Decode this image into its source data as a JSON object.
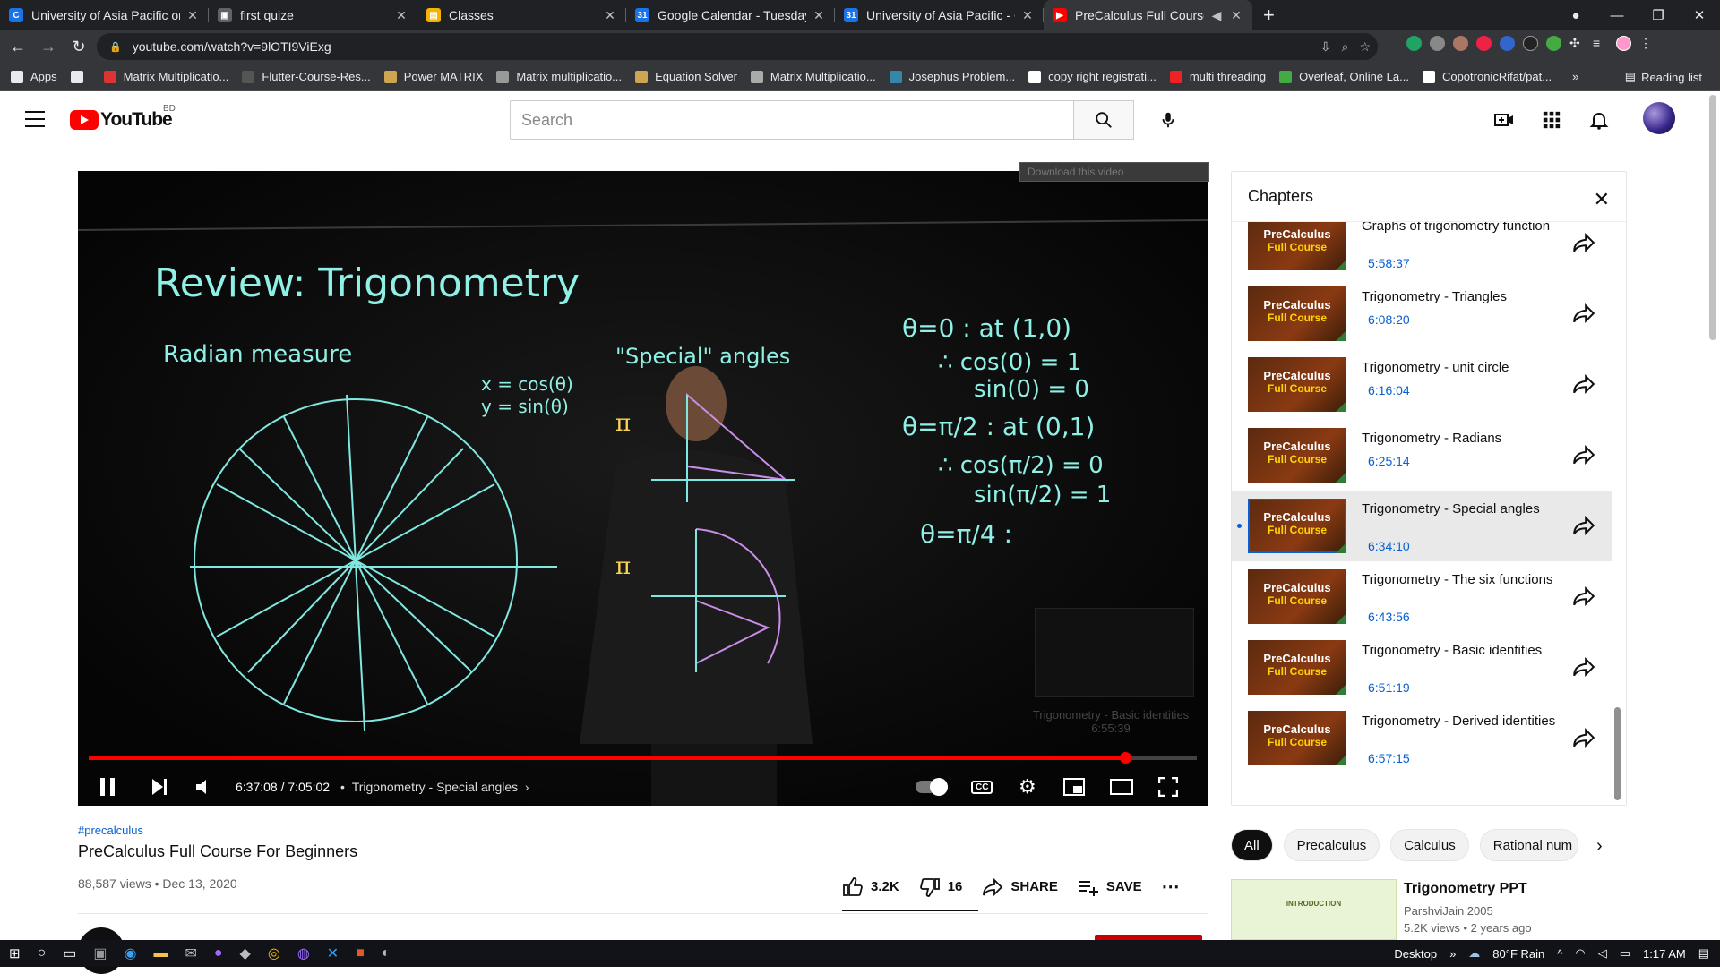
{
  "browser": {
    "tabs": [
      {
        "title": "University of Asia Pacific on Cour",
        "icon": "classroom-icon",
        "color": "#1a73e8",
        "glyph": "C",
        "active": false
      },
      {
        "title": "first quize",
        "icon": "form-icon",
        "color": "#5f6368",
        "glyph": "▣",
        "active": false
      },
      {
        "title": "Classes",
        "icon": "classroom-icon",
        "color": "#f4b400",
        "glyph": "▤",
        "active": false
      },
      {
        "title": "Google Calendar - Tuesday, Augu",
        "icon": "calendar-icon",
        "color": "#1a73e8",
        "glyph": "31",
        "active": false
      },
      {
        "title": "University of Asia Pacific - Calenda",
        "icon": "calendar-icon",
        "color": "#1a73e8",
        "glyph": "31",
        "active": false
      },
      {
        "title": "PreCalculus Full Course For B",
        "icon": "youtube-icon",
        "color": "#ff0000",
        "glyph": "▶",
        "active": true
      }
    ],
    "url": "youtube.com/watch?v=9lOTI9ViExg",
    "bookmarks": [
      {
        "label": "Apps",
        "color": "#e8eaed"
      },
      {
        "label": "",
        "color": "#e8eaed"
      },
      {
        "label": "Matrix Multiplicatio...",
        "color": "#d33"
      },
      {
        "label": "Flutter-Course-Res...",
        "color": "#555"
      },
      {
        "label": "Power MATRIX",
        "color": "#cfa650"
      },
      {
        "label": "Matrix multiplicatio...",
        "color": "#999"
      },
      {
        "label": "Equation Solver",
        "color": "#cfa650"
      },
      {
        "label": "Matrix Multiplicatio...",
        "color": "#aaa"
      },
      {
        "label": "Josephus Problem...",
        "color": "#38a"
      },
      {
        "label": "copy right registrati...",
        "color": "#fff"
      },
      {
        "label": "multi threading",
        "color": "#e22"
      },
      {
        "label": "Overleaf, Online La...",
        "color": "#4a4"
      },
      {
        "label": "CopotronicRifat/pat...",
        "color": "#fff"
      }
    ],
    "reading_list": "Reading list"
  },
  "youtube": {
    "logo_text": "YouTube",
    "country_code": "BD",
    "search_placeholder": "Search"
  },
  "player": {
    "download_banner": "Download this video",
    "time_current": "6:37:08",
    "time_total": "7:05:02",
    "time_display": "6:37:08 / 7:05:02",
    "chapter_label": "Trigonometry - Special angles",
    "progress_fraction": 0.935,
    "next_chapter": "Trigonometry - Basic identities",
    "next_time": "6:55:39",
    "board_text": {
      "title": "Review: Trigonometry",
      "radian": "Radian measure",
      "special": "\"Special\" angles",
      "xeq": "x = cos(θ)",
      "yeq": "y = sin(θ)",
      "r1": "θ=0 : at (1,0)",
      "r2": "∴ cos(0) = 1",
      "r3": "sin(0) = 0",
      "r4": "θ=π/2 : at (0,1)",
      "r5": "∴ cos(π/2) = 0",
      "r6": "sin(π/2) = 1",
      "r7": "θ=π/4 :"
    }
  },
  "chapters": {
    "heading": "Chapters",
    "items": [
      {
        "title": "Graphs of trigonometry function",
        "time": "5:58:37",
        "active": false
      },
      {
        "title": "Trigonometry - Triangles",
        "time": "6:08:20",
        "active": false
      },
      {
        "title": "Trigonometry - unit circle",
        "time": "6:16:04",
        "active": false
      },
      {
        "title": "Trigonometry - Radians",
        "time": "6:25:14",
        "active": false
      },
      {
        "title": "Trigonometry - Special angles",
        "time": "6:34:10",
        "active": true
      },
      {
        "title": "Trigonometry - The six functions",
        "time": "6:43:56",
        "active": false
      },
      {
        "title": "Trigonometry - Basic identities",
        "time": "6:51:19",
        "active": false
      },
      {
        "title": "Trigonometry - Derived identities",
        "time": "6:57:15",
        "active": false
      }
    ],
    "thumb_line1": "PreCalculus",
    "thumb_line2": "Full Course"
  },
  "video": {
    "hashtag": "#precalculus",
    "title": "PreCalculus Full Course For Beginners",
    "views": "88,587 views",
    "date": "Dec 13, 2020",
    "views_line": "88,587 views • Dec 13, 2020",
    "likes": "3.2K",
    "dislikes": "16",
    "share": "SHARE",
    "save": "SAVE"
  },
  "chips": [
    "All",
    "Precalculus",
    "Calculus",
    "Rational num"
  ],
  "recommendation": {
    "title": "Trigonometry PPT",
    "channel": "ParshviJain 2005",
    "meta": "5.2K views • 2 years ago",
    "thumb_heading": "INTRODUCTION"
  },
  "taskbar": {
    "desktop": "Desktop",
    "weather": "80°F  Rain",
    "clock": "1:17 AM"
  }
}
